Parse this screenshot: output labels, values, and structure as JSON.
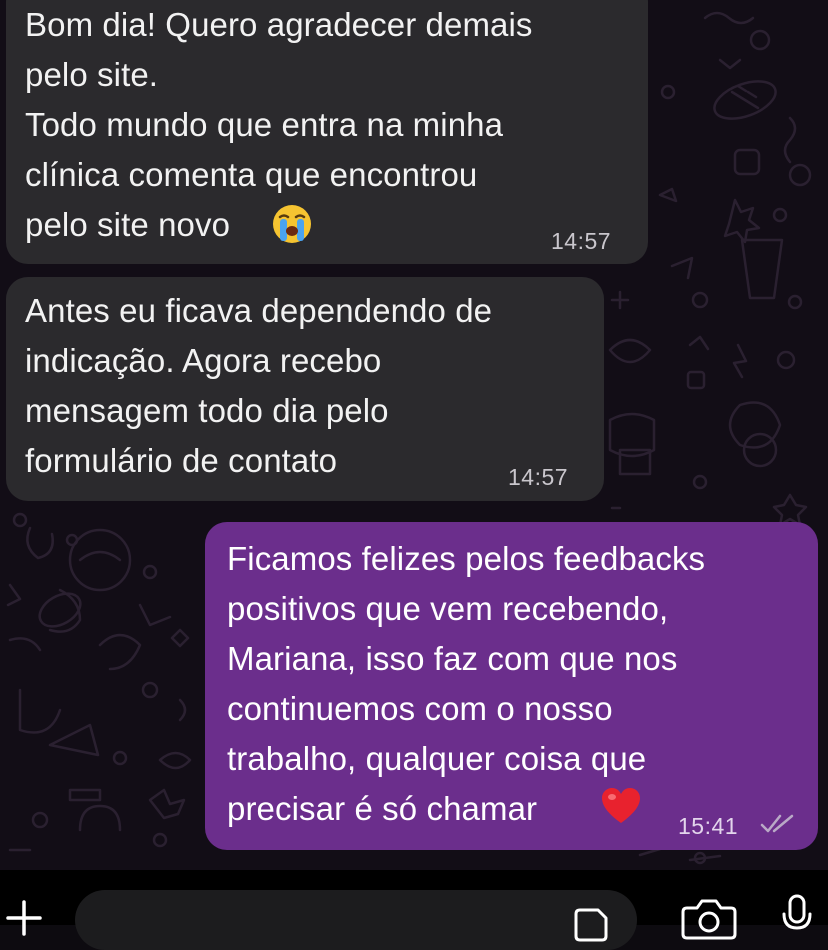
{
  "messages": [
    {
      "direction": "incoming",
      "text": "Bom dia! Quero agradecer demais\npelo site.\nTodo mundo que entra na minha\nclínica comenta que encontrou\npelo site novo",
      "emoji": "crying-face",
      "time": "14:57"
    },
    {
      "direction": "incoming",
      "text": "Antes eu ficava dependendo de\nindicação. Agora recebo\nmensagem todo dia pelo\nformulário de contato",
      "time": "14:57"
    },
    {
      "direction": "outgoing",
      "text": "Ficamos felizes pelos feedbacks\npositivos que vem recebendo,\nMariana, isso faz com que nos\ncontinuemos com o nosso\ntrabalho, qualquer coisa que\nprecisar é só chamar",
      "emoji": "red-heart",
      "time": "15:41",
      "status": "read"
    }
  ],
  "colors": {
    "incoming_bubble": "#2b2a2d",
    "outgoing_bubble": "#6b2e8c",
    "background": "#120d16",
    "read_ticks": "#b9a9c6"
  },
  "icons": {
    "attach": "plus-icon",
    "sticker": "sticker-icon",
    "camera": "camera-icon",
    "mic": "microphone-icon"
  }
}
